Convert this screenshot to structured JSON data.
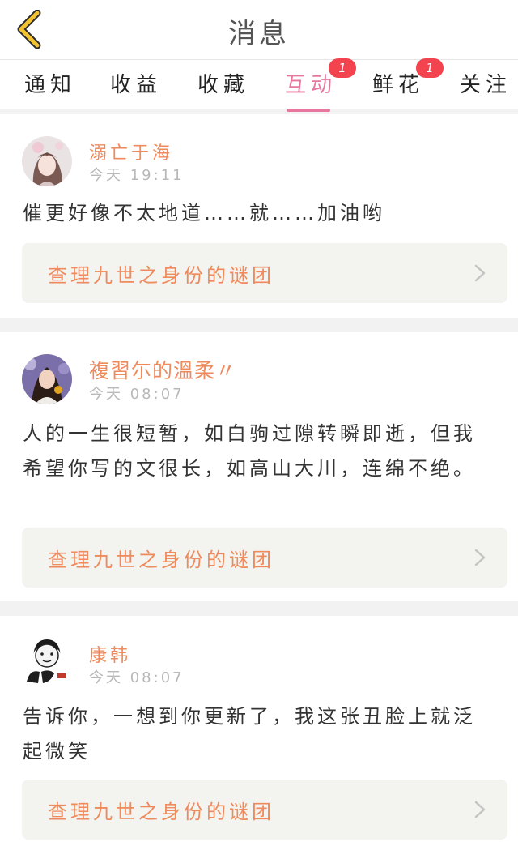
{
  "header": {
    "title": "消息",
    "back_icon": "chevron-left-icon",
    "back_color": "#f2c230"
  },
  "tabs": [
    {
      "label": "通知"
    },
    {
      "label": "收益"
    },
    {
      "label": "收藏"
    },
    {
      "label": "互动",
      "active": true,
      "badge": "1"
    },
    {
      "label": "鲜花",
      "badge": "1"
    },
    {
      "label": "关注"
    }
  ],
  "colors": {
    "accent_pink": "#e8779f",
    "username_orange": "#ee8a5c",
    "badge_red": "#f2434f",
    "link_bg": "#f3f3ef"
  },
  "messages": [
    {
      "username": "溺亡于海",
      "time": "今天 19:11",
      "content": "催更好像不太地道……就……加油哟",
      "link_label": "查理九世之身份的谜团",
      "avatar_icon": "anime-girl-avatar"
    },
    {
      "username": "複習尓的溫柔〃",
      "time": "今天 08:07",
      "content": "人的一生很短暂，如白驹过隙转瞬即逝，但我希望你写的文很长，如高山大川，连绵不绝。",
      "link_label": "查理九世之身份的谜团",
      "avatar_icon": "girl-photo-avatar"
    },
    {
      "username": "康韩",
      "time": "今天 08:07",
      "content": "告诉你，一想到你更新了，我这张丑脸上就泛起微笑",
      "link_label": "查理九世之身份的谜团",
      "avatar_icon": "cartoon-xiuxian-avatar"
    }
  ]
}
